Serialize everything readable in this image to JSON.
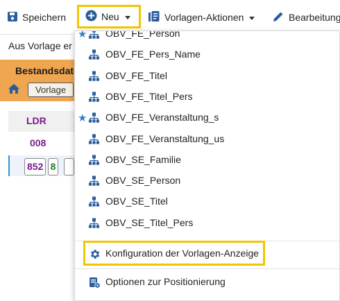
{
  "toolbar": {
    "save_label": "Speichern",
    "neu_label": "Neu",
    "vorlagen_label": "Vorlagen-Aktionen",
    "bearbeitung_label": "Bearbeitung"
  },
  "background": {
    "vorlage_line": "Aus Vorlage er",
    "panel_title": "Bestandsdate",
    "vorlage_chip": "Vorlage",
    "ldr_header": "LDR",
    "code_008": "008",
    "code_852": "852",
    "indicator_8": "8"
  },
  "menu": {
    "templates": [
      {
        "label": "OBV_FE_Person",
        "favorite": true
      },
      {
        "label": "OBV_FE_Pers_Name",
        "favorite": false
      },
      {
        "label": "OBV_FE_Titel",
        "favorite": false
      },
      {
        "label": "OBV_FE_Titel_Pers",
        "favorite": false
      },
      {
        "label": "OBV_FE_Veranstaltung_s",
        "favorite": true
      },
      {
        "label": "OBV_FE_Veranstaltung_us",
        "favorite": false
      },
      {
        "label": "OBV_SE_Familie",
        "favorite": false
      },
      {
        "label": "OBV_SE_Person",
        "favorite": false
      },
      {
        "label": "OBV_SE_Titel",
        "favorite": false
      },
      {
        "label": "OBV_SE_Titel_Pers",
        "favorite": false
      }
    ],
    "config_label": "Konfiguration der Vorlagen-Anzeige",
    "positioning_label": "Optionen zur Positionierung"
  },
  "colors": {
    "accent_highlight": "#f2c500",
    "panel_orange": "#f0a650",
    "icon_blue": "#2a5d9e",
    "favorite_star": "#2f7fc4",
    "code_purple": "#7a1b8a",
    "code_green": "#1e7d1e"
  }
}
